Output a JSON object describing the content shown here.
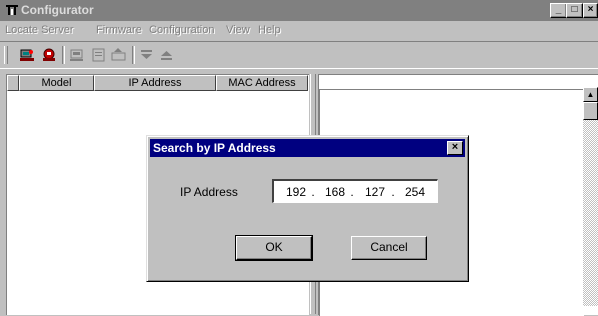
{
  "window": {
    "title": "Configurator",
    "minimize_glyph": "_",
    "maximize_glyph": "□",
    "close_glyph": "×"
  },
  "menu": {
    "items": [
      {
        "label": "Locate Server"
      },
      {
        "label": "Firmware"
      },
      {
        "label": "Configuration"
      },
      {
        "label": "View"
      },
      {
        "label": "Help"
      }
    ]
  },
  "toolbar": {
    "icons": [
      "locate-server-icon",
      "stop-icon",
      "server-config-icon",
      "properties-icon",
      "firmware-icon",
      "down-icon",
      "eject-icon"
    ]
  },
  "list": {
    "columns": [
      "Model",
      "IP Address",
      "MAC Address"
    ]
  },
  "dialog": {
    "title": "Search by IP Address",
    "close_glyph": "×",
    "ip_label": "IP Address",
    "ip_octets": [
      "192",
      "168",
      "127",
      "254"
    ],
    "ok_label": "OK",
    "cancel_label": "Cancel"
  },
  "scrollbar": {
    "up_glyph": "▲"
  },
  "colors": {
    "face": "#c0c0c0",
    "active_title": "#000080",
    "inactive_title": "#808080"
  }
}
